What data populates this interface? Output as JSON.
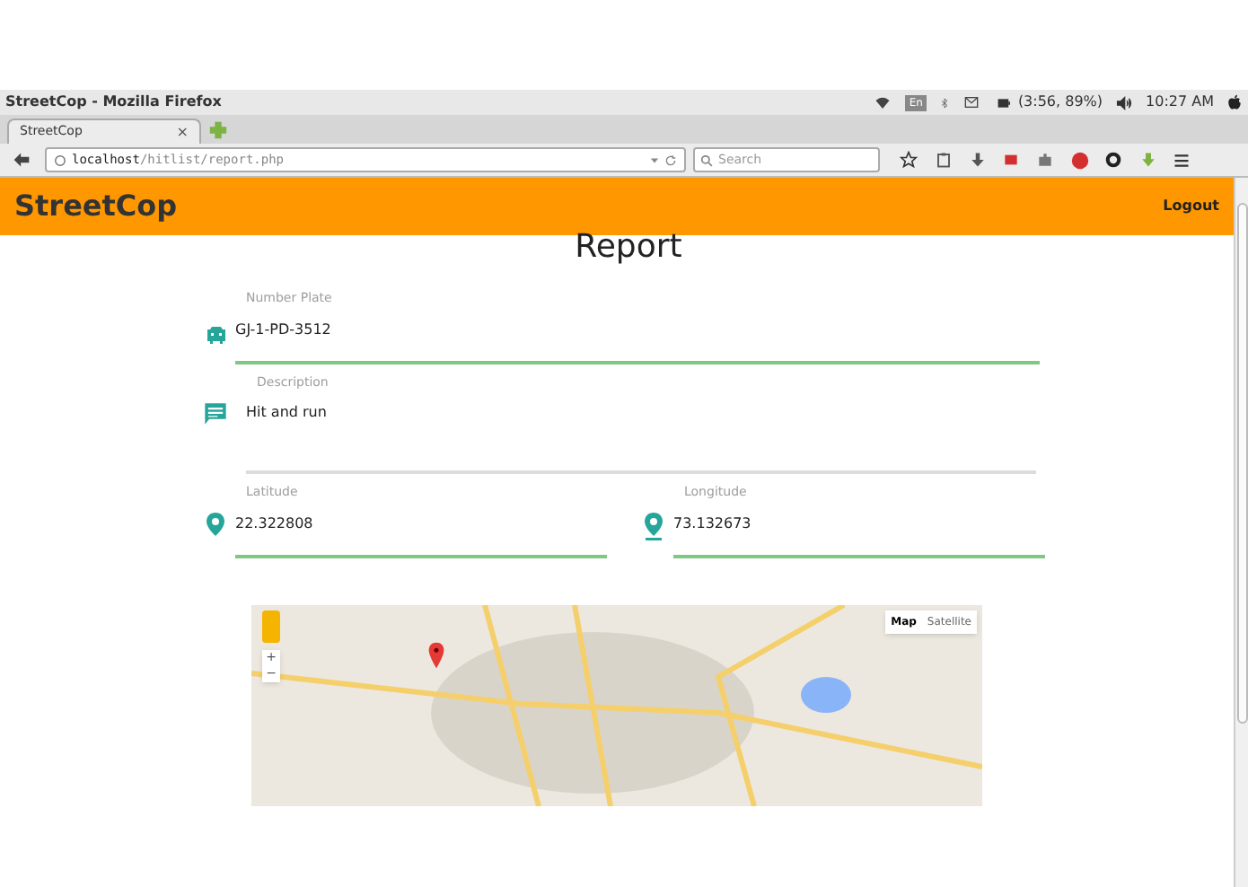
{
  "os_bar": {
    "title": "StreetCop - Mozilla Firefox",
    "keyboard": "En",
    "battery": "(3:56, 89%)",
    "time": "10:27 AM"
  },
  "browser": {
    "tab": {
      "title": "StreetCop",
      "close": "×"
    },
    "url_host": "localhost",
    "url_path": "/hitlist/report.php",
    "search": {
      "placeholder": "Search"
    }
  },
  "header": {
    "brand": "StreetCop",
    "logout": "Logout"
  },
  "page": {
    "title": "Report",
    "fields": [
      {
        "kind": "plate",
        "label": "Number Plate",
        "value": "GJ-1-PD-3512",
        "focused": true
      },
      {
        "kind": "description",
        "label": "Description",
        "value": "Hit and run",
        "focused": false
      }
    ],
    "coords": [
      {
        "label": "Latitude",
        "value": "22.322808",
        "focused": true
      },
      {
        "label": "Longitude",
        "value": "73.132673",
        "focused": true
      }
    ],
    "map": {
      "types": [
        {
          "label": "Map",
          "selected": true
        },
        {
          "label": "Satellite",
          "selected": false
        }
      ],
      "zoom_in": "+",
      "zoom_out": "−"
    }
  }
}
